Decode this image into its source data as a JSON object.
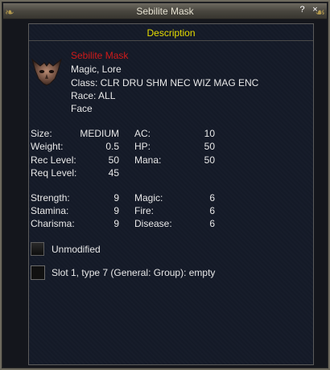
{
  "window": {
    "title": "Sebilite Mask",
    "help_btn": "?",
    "min_btn": "×"
  },
  "section": {
    "title": "Description"
  },
  "item": {
    "icon": "bat-mask-icon",
    "name": "Sebilite Mask",
    "flags": "Magic, Lore",
    "class_line": "Class: CLR DRU SHM NEC WIZ MAG ENC",
    "race_line": "Race: ALL",
    "slot_line": "Face"
  },
  "stats": {
    "size_label": "Size:",
    "size_value": "MEDIUM",
    "weight_label": "Weight:",
    "weight_value": "0.5",
    "rec_label": "Rec Level:",
    "rec_value": "50",
    "req_label": "Req Level:",
    "req_value": "45",
    "ac_label": "AC:",
    "ac_value": "10",
    "hp_label": "HP:",
    "hp_value": "50",
    "mana_label": "Mana:",
    "mana_value": "50"
  },
  "attributes": {
    "str_label": "Strength:",
    "str_value": "9",
    "sta_label": "Stamina:",
    "sta_value": "9",
    "cha_label": "Charisma:",
    "cha_value": "9",
    "magic_label": "Magic:",
    "magic_value": "6",
    "fire_label": "Fire:",
    "fire_value": "6",
    "disease_label": "Disease:",
    "disease_value": "6"
  },
  "augments": {
    "unmodified_label": "Unmodified",
    "slot1_label": "Slot 1, type 7 (General: Group): empty"
  },
  "colors": {
    "name": "#d01a1a",
    "section_title": "#e7dd00",
    "text": "#e8e8e8"
  }
}
